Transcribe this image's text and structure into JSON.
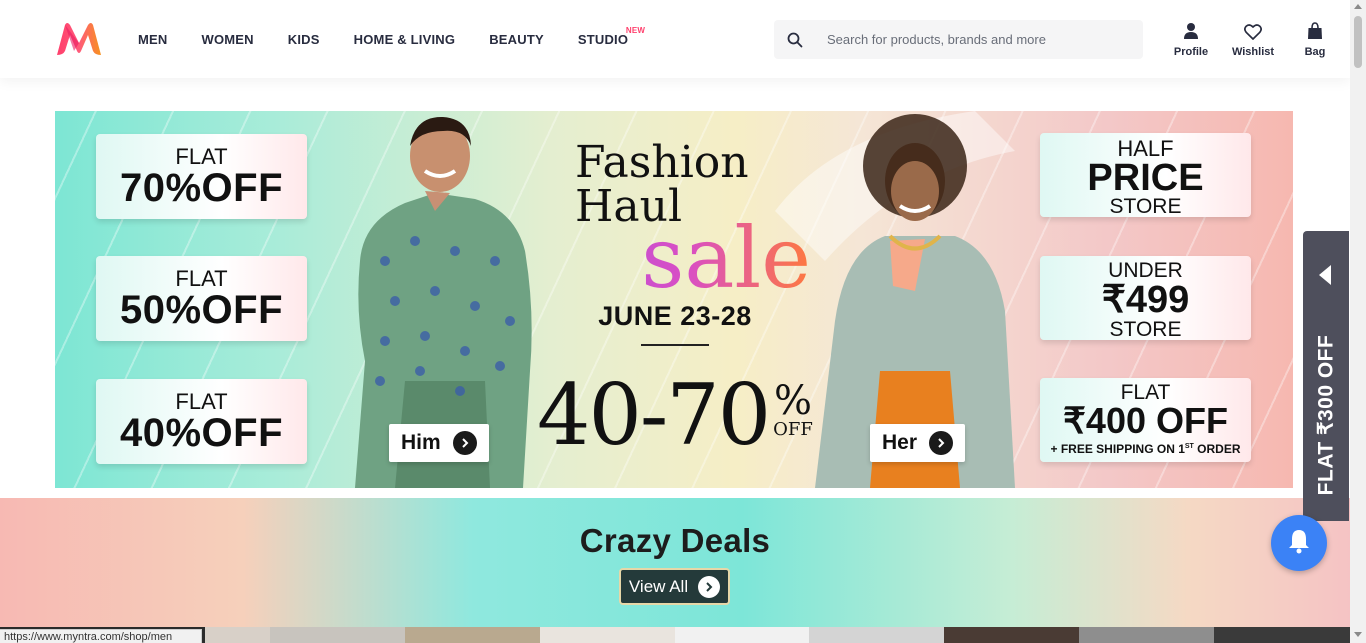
{
  "header": {
    "nav": [
      "MEN",
      "WOMEN",
      "KIDS",
      "HOME & LIVING",
      "BEAUTY",
      "STUDIO"
    ],
    "studio_badge": "NEW",
    "search": {
      "placeholder": "Search for products, brands and more",
      "icon": "search-icon"
    },
    "actions": [
      {
        "label": "Profile",
        "icon": "profile-icon"
      },
      {
        "label": "Wishlist",
        "icon": "heart-icon"
      },
      {
        "label": "Bag",
        "icon": "bag-icon"
      }
    ]
  },
  "banner": {
    "left_offers": [
      {
        "small": "FLAT",
        "big": "70%OFF"
      },
      {
        "small": "FLAT",
        "big": "50%OFF"
      },
      {
        "small": "FLAT",
        "big": "40%OFF"
      }
    ],
    "title_line1": "Fashion",
    "title_line2": "Haul",
    "sale": "sale",
    "dates": "JUNE 23-28",
    "discount": "40-70",
    "percent": "%",
    "off": "OFF",
    "him_label": "Him",
    "her_label": "Her",
    "right_offers": {
      "half_top": "HALF",
      "half_mid": "PRICE",
      "half_bot": "STORE",
      "under_top": "UNDER",
      "under_mid": "₹499",
      "under_bot": "STORE",
      "flat_top": "FLAT",
      "flat_mid": "₹400 OFF",
      "flat_bot_a": "+ FREE SHIPPING ON 1",
      "flat_bot_sup": "ST",
      "flat_bot_b": " ORDER"
    }
  },
  "deals": {
    "title": "Crazy Deals",
    "view_all": "View All"
  },
  "side_tab": {
    "text": "FLAT ₹300 OFF"
  },
  "status_url": "https://www.myntra.com/shop/men",
  "colors": {
    "brand_pink": "#ff3f6c",
    "text_dark": "#282c3f",
    "side_tab": "#4e4f5c",
    "bell": "#3b82f6"
  }
}
